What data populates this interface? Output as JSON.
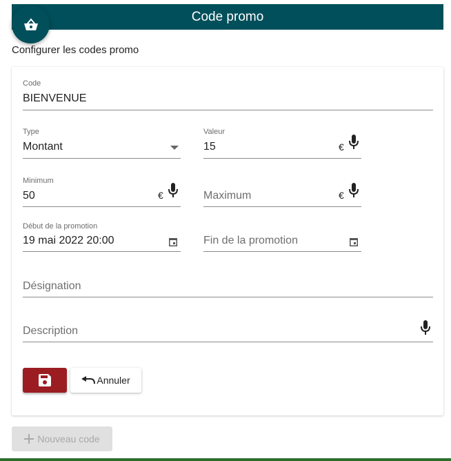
{
  "header": {
    "title": "Code promo",
    "basket_icon": "shopping-basket-icon"
  },
  "page": {
    "subtitle": "Configurer les codes promo"
  },
  "form": {
    "code": {
      "label": "Code",
      "value": "BIENVENUE"
    },
    "type": {
      "label": "Type",
      "value": "Montant"
    },
    "valeur": {
      "label": "Valeur",
      "value": "15",
      "suffix": "€"
    },
    "minimum": {
      "label": "Minimum",
      "value": "50",
      "suffix": "€"
    },
    "maximum": {
      "placeholder": "Maximum",
      "suffix": "€"
    },
    "debut": {
      "label": "Début de la promotion",
      "value": "19 mai 2022 20:00"
    },
    "fin": {
      "placeholder": "Fin de la promotion"
    },
    "designation": {
      "placeholder": "Désignation"
    },
    "description": {
      "placeholder": "Description"
    }
  },
  "actions": {
    "save_icon": "floppy-disk-icon",
    "cancel_label": "Annuler",
    "cancel_icon": "undo-icon",
    "new_label": "Nouveau code",
    "new_icon": "plus-icon"
  },
  "colors": {
    "header": "#004f5a",
    "save": "#9b1d22",
    "bottom_bar": "#2c6e2c"
  }
}
